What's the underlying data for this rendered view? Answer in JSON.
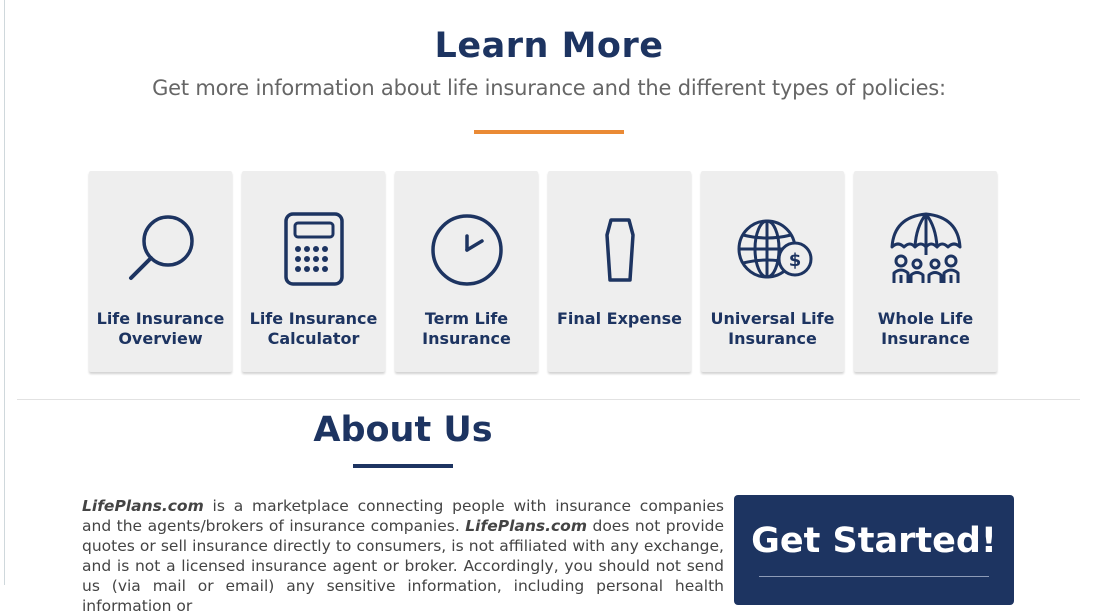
{
  "learn_more": {
    "title": "Learn More",
    "subtitle": "Get more information about life insurance and the different types of policies:",
    "cards": [
      {
        "label": "Life Insurance\nOverview",
        "icon": "magnifying-glass-icon"
      },
      {
        "label": "Life Insurance\nCalculator",
        "icon": "calculator-icon"
      },
      {
        "label": "Term Life\nInsurance",
        "icon": "clock-icon"
      },
      {
        "label": "Final Expense",
        "icon": "coffin-icon"
      },
      {
        "label": "Universal Life\nInsurance",
        "icon": "globe-dollar-icon"
      },
      {
        "label": "Whole Life\nInsurance",
        "icon": "umbrella-family-icon"
      }
    ]
  },
  "about": {
    "title": "About Us",
    "brand": "LifePlans.com",
    "text_1": " is a marketplace connecting people with insurance companies and the agents/brokers of insurance companies. ",
    "text_2": " does not provide quotes or sell insurance directly to consumers, is not affiliated with any exchange, and is not a licensed insurance agent or broker. Accordingly, you should not send us (via mail or email) any sensitive information, including personal health information or"
  },
  "cta": {
    "label": "Get Started!"
  },
  "colors": {
    "navy": "#1d3461",
    "orange": "#ea8a35",
    "card_bg": "#eeeeee",
    "text": "#444444"
  }
}
